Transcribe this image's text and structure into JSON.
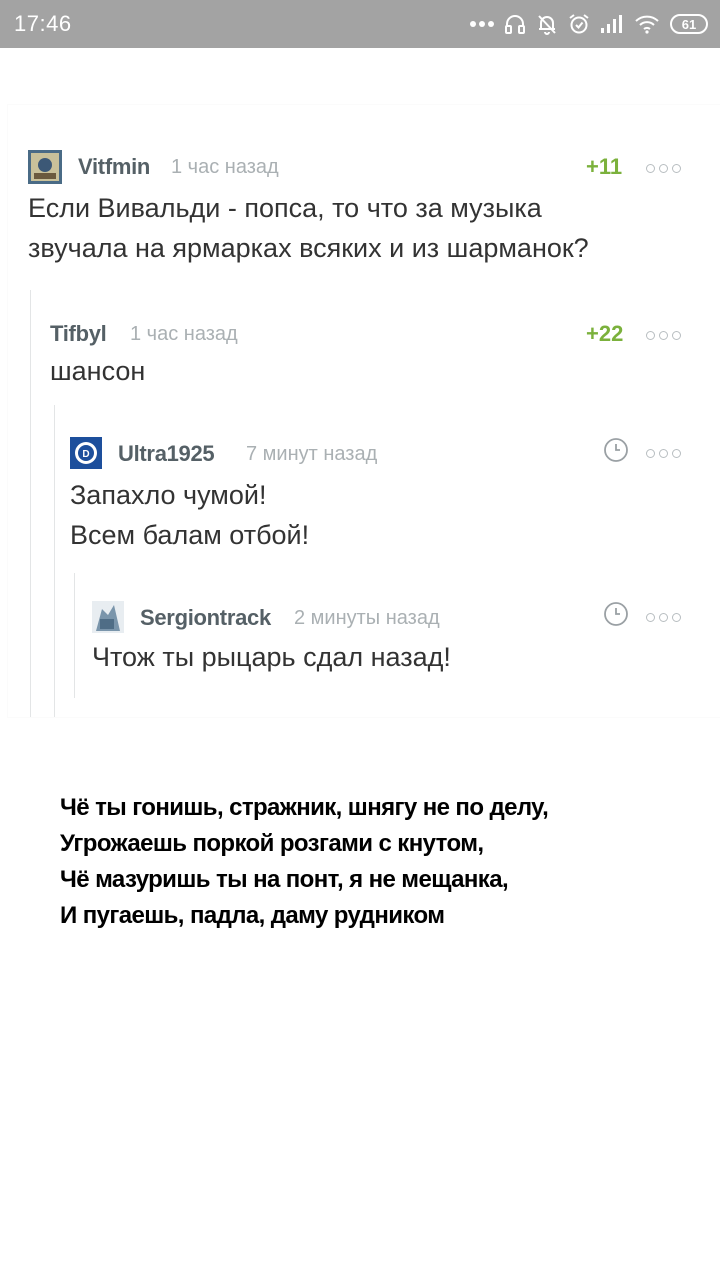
{
  "status_bar": {
    "time": "17:46",
    "battery": "61",
    "icons": [
      "dots-icon",
      "headphones-icon",
      "bell-muted-icon",
      "alarm-icon",
      "signal-icon",
      "wifi-icon",
      "battery-icon"
    ]
  },
  "comments": [
    {
      "author": "Vitfmin",
      "time_ago": "1 час назад",
      "score": "+11",
      "lines": [
        "Если Вивальди - попса, то что за музыка",
        "звучала на ярмарках всяких и из шарманок?"
      ]
    },
    {
      "author": "Tifbyl",
      "time_ago": "1 час назад",
      "score": "+22",
      "lines": [
        "шансон"
      ]
    },
    {
      "author": "Ultra1925",
      "time_ago": "7 минут назад",
      "lines": [
        "Запахло чумой!",
        "Всем балам отбой!"
      ]
    },
    {
      "author": "Sergiontrack",
      "time_ago": "2 минуты назад",
      "lines": [
        "Чтож ты рыцарь сдал назад!"
      ]
    }
  ],
  "poem": {
    "lines": [
      "Чё ты гонишь, стражник, шнягу не по делу,",
      "Угрожаешь поркой розгами с кнутом,",
      "Чё мазуришь ты на понт, я не мещанка,",
      "И пугаешь, падла, даму рудником"
    ]
  },
  "colors": {
    "status_bar": "#a3a3a3",
    "author": "#556066",
    "time_ago": "#aab0b3",
    "score": "#7bb13c",
    "text": "#333333"
  }
}
